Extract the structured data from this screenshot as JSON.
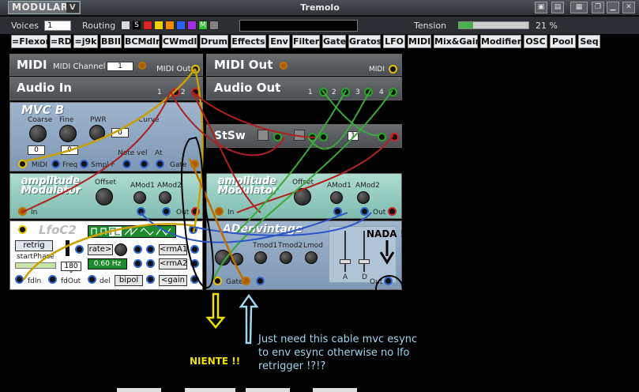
{
  "window": {
    "logo": "MODULAR",
    "logo_v": "V",
    "title": "Tremolo"
  },
  "toolbar": {
    "voices_label": "Voices",
    "voices_value": "1",
    "routing_label": "Routing",
    "routing_s": "S",
    "routing_m": "M",
    "routing_colors": [
      "#d9d9d9",
      "#000000",
      "#e02020",
      "#f0d000",
      "#f08a00",
      "#3060ff",
      "#a030e0",
      "#30c030",
      "#808080"
    ],
    "tension_label": "Tension",
    "tension_value": "21 %",
    "tension_fraction": 0.21
  },
  "categories": [
    "=Flexor",
    "=RD",
    "=j9k",
    "BBII",
    "BCMdlr",
    "CWmdl",
    "Drum",
    "Effects",
    "Env",
    "Filter",
    "Gate",
    "Gratos",
    "LFO",
    "MIDI",
    "Mix&Gain",
    "Modifier",
    "OSC",
    "Pool",
    "Seq"
  ],
  "modules": {
    "midi": {
      "title": "MIDI",
      "channel_label": "MIDI Channel",
      "channel_value": "1",
      "out_label": "MIDI Out"
    },
    "audio_in": {
      "title": "Audio In",
      "ports": [
        "1",
        "2"
      ]
    },
    "midi_out": {
      "title": "MIDI Out",
      "port_label": "MIDI"
    },
    "audio_out": {
      "title": "Audio Out",
      "ports": [
        "1",
        "2",
        "3",
        "4"
      ]
    },
    "mvc": {
      "title": "MVC B",
      "coarse": "Coarse",
      "fine": "Fine",
      "pwr": "PWR",
      "curve": "Curve",
      "coarse_val": "0",
      "fine_val": "0",
      "pwr_val": "0",
      "note_vel": "Note vel",
      "at": "At",
      "midi": "MIDI",
      "freq": "Freq",
      "smpl_f": "Smpl F",
      "gate": "Gate"
    },
    "stsw": {
      "title": "StSw",
      "value": "1"
    },
    "am1": {
      "title1": "amplitude",
      "title2": "Modulator",
      "offset": "Offset",
      "amod1": "AMod1",
      "amod2": "AMod2",
      "in": "In",
      "out": "Out"
    },
    "am2": {
      "title1": "amplitude",
      "title2": "Modulator",
      "offset": "Offset",
      "amod1": "AMod1",
      "amod2": "AMod2",
      "in": "In",
      "out": "Out"
    },
    "lfo": {
      "title": "LfoC2",
      "retrig": "retrig",
      "start_phase": "startPhase",
      "phase_val": "180 °",
      "freq_val": "0.60 Hz",
      "rate": "rate>",
      "rma1": "<rmA1",
      "rma2": "<rmA2",
      "gain": "<gain",
      "fdin": "fdIn",
      "fdout": "fdOut",
      "del": "del",
      "bipol": "bipol"
    },
    "env": {
      "title": "ADenvintage",
      "tmod1": "Tmod1",
      "tmod2": "Tmod2",
      "lmod": "Lmod",
      "a": "A",
      "d": "D",
      "gate": "Gate",
      "out": "Out"
    }
  },
  "annotations": {
    "nada": "NADA !",
    "niente": "NIENTE !!",
    "note": "Just need this cable mvc esync to env esync otherwise no lfo retrigger !?!?"
  }
}
